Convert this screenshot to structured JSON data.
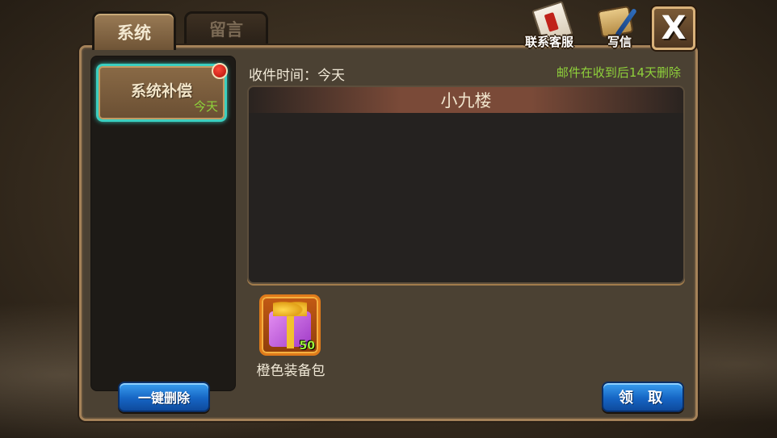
{
  "tabs": [
    {
      "label": "系统",
      "active": true
    },
    {
      "label": "留言",
      "active": false
    }
  ],
  "top_actions": {
    "contact_service_label": "联系客服",
    "write_letter_label": "写信",
    "close_label": "X"
  },
  "mail_list": {
    "items": [
      {
        "title": "系统补偿",
        "date": "今天",
        "unread": true,
        "selected": true
      }
    ]
  },
  "mail_detail": {
    "received_label": "收件时间：今天",
    "notice": "邮件在收到后14天删除",
    "sender": "小九楼",
    "body": ""
  },
  "reward": {
    "icon": "gift-box-icon",
    "count": "50",
    "name": "橙色装备包"
  },
  "buttons": {
    "delete_all_label": "一键删除",
    "claim_label": "领 取"
  },
  "colors": {
    "accent_green": "#8fd13b",
    "button_blue": "#1665c4",
    "selection_teal": "#3bcfc0",
    "unread_red": "#c0221a"
  }
}
